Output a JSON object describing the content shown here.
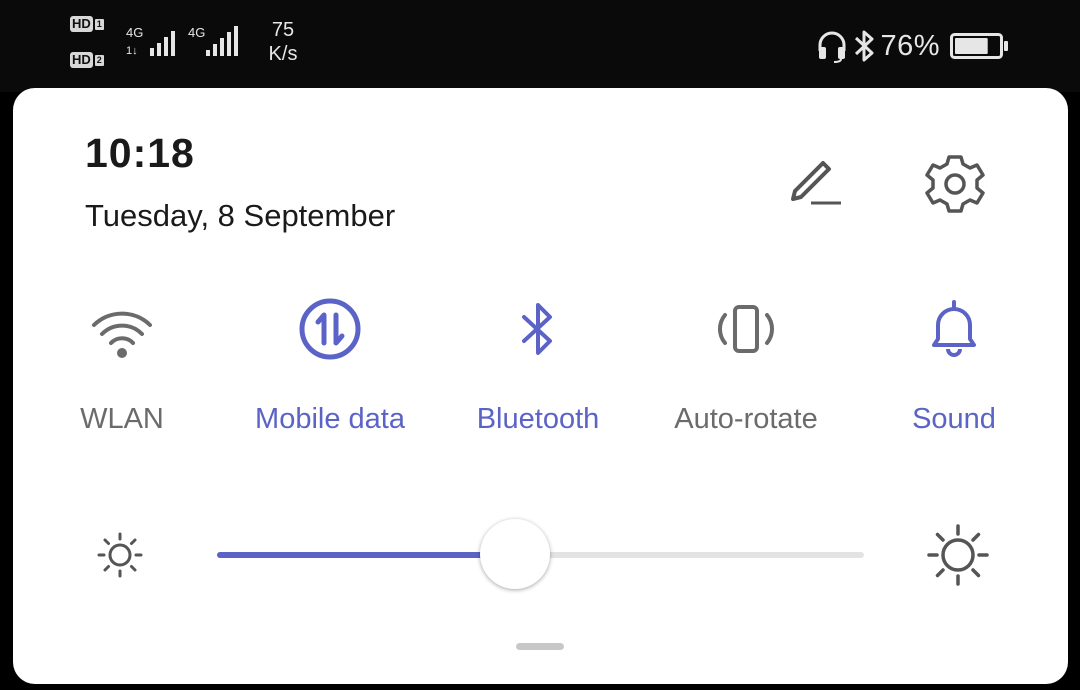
{
  "status_bar": {
    "sim1_label": "HD",
    "sim1_index": "1",
    "sim2_label": "HD",
    "sim2_index": "2",
    "network1": "4G",
    "network2": "4G",
    "speed_value": "75",
    "speed_unit": "K/s",
    "battery_percent": "76%",
    "battery_level": 0.76,
    "icons": [
      "headset-icon",
      "bluetooth-icon",
      "battery-icon"
    ]
  },
  "header": {
    "time": "10:18",
    "date": "Tuesday, 8 September",
    "icons": [
      "edit-pencil-icon",
      "settings-gear-icon"
    ]
  },
  "tiles": [
    {
      "label": "WLAN",
      "icon": "wifi-icon",
      "active": false
    },
    {
      "label": "Mobile data",
      "icon": "mobile-data-icon",
      "active": true
    },
    {
      "label": "Bluetooth",
      "icon": "bluetooth-icon",
      "active": true
    },
    {
      "label": "Auto-rotate",
      "icon": "auto-rotate-icon",
      "active": false
    },
    {
      "label": "Sound",
      "icon": "bell-icon",
      "active": true
    }
  ],
  "brightness": {
    "level": 0.46,
    "icons": [
      "brightness-low-icon",
      "brightness-high-icon"
    ]
  },
  "colors": {
    "accent": "#5b64c6",
    "inactive": "#6b6b6b",
    "panel_bg": "#ffffff",
    "status_bg": "#0a0a0a"
  }
}
